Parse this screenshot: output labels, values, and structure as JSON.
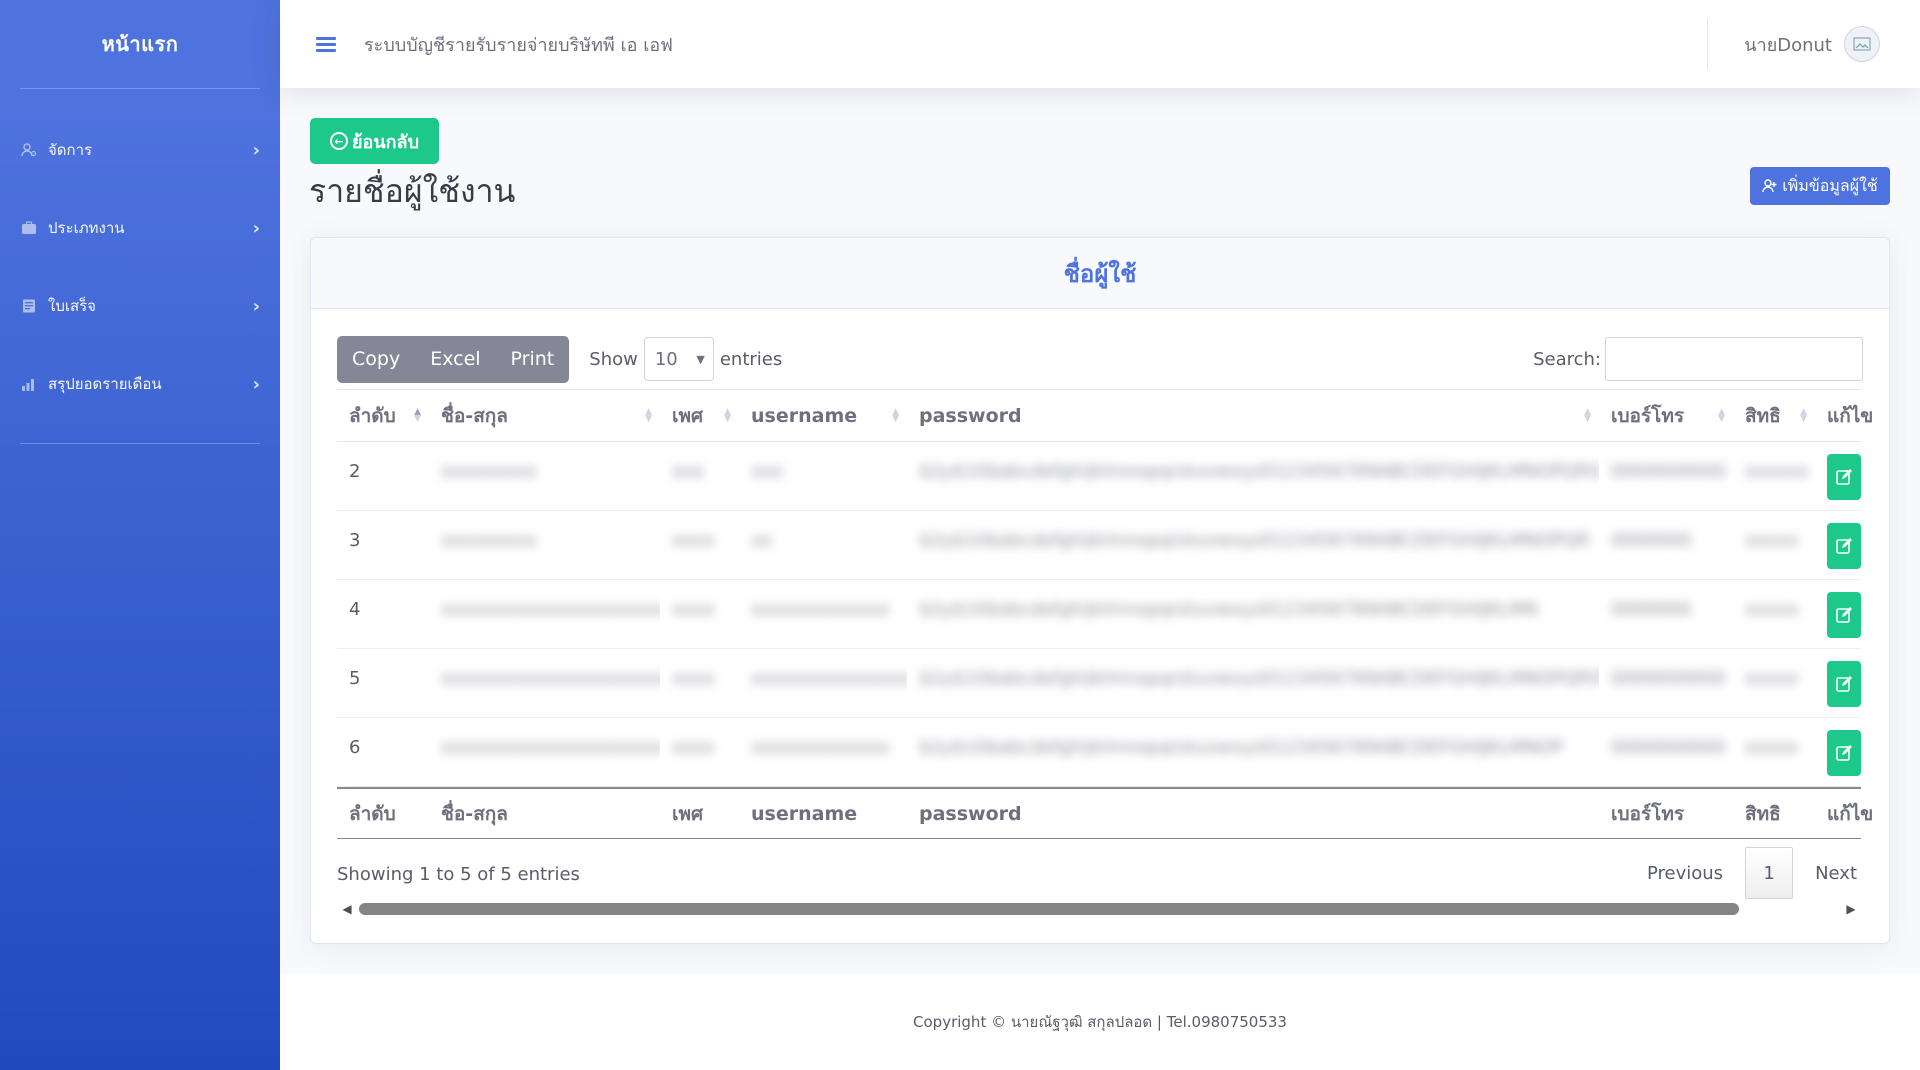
{
  "sidebar": {
    "brand": "หน้าแรก",
    "items": [
      {
        "label": "จัดการ",
        "icon": "users-cog-icon"
      },
      {
        "label": "ประเภทงาน",
        "icon": "briefcase-icon"
      },
      {
        "label": "ใบเสร็จ",
        "icon": "receipt-icon"
      },
      {
        "label": "สรุปยอดรายเดือน",
        "icon": "bar-chart-icon"
      }
    ]
  },
  "topbar": {
    "title": "ระบบบัญชีรายรับรายจ่ายบริษัทพี เอ เอฟ",
    "user_name": "นายDonut"
  },
  "page": {
    "back_label": "ย้อนกลับ",
    "title": "รายชื่อผู้ใช้งาน",
    "add_label": "เพิ่มข้อมูลผู้ใช้"
  },
  "card": {
    "header": "ชื่อผู้ใช้"
  },
  "datatable": {
    "buttons": {
      "copy": "Copy",
      "excel": "Excel",
      "print": "Print"
    },
    "show_label": "Show",
    "entries_label": "entries",
    "page_length": "10",
    "search_label": "Search:",
    "search_value": "",
    "columns": [
      "ลำดับ",
      "ชื่อ-สกุล",
      "เพศ",
      "username",
      "password",
      "เบอร์โทร",
      "สิทธิ",
      "แก้ไข"
    ],
    "rows": [
      {
        "no": "2",
        "name": "xxxxxxxxx",
        "gender": "xxx",
        "username": "xxx",
        "password": "$2y$10$abcdefghijklmnopqrstuvwxyz0123456789ABCDEFGHIJKLMNOPQRS",
        "phone": "0000000000",
        "role": "xxxxxx"
      },
      {
        "no": "3",
        "name": "xxxxxxxxx",
        "gender": "xxxx",
        "username": "xx",
        "password": "$2y$10$abcdefghijklmnopqrstuvwxyz0123456789ABCDEFGHIJKLMNOPQR",
        "phone": "0000000",
        "role": "xxxxx"
      },
      {
        "no": "4",
        "name": "xxxxxxxxxxxxxxxxxxxxx",
        "gender": "xxxx",
        "username": "xxxxxxxxxxxxx",
        "password": "$2y$10$abcdefghijklmnopqrstuvwxyz0123456789ABCDEFGHIJKLMN",
        "phone": "0000000",
        "role": "xxxxx"
      },
      {
        "no": "5",
        "name": "xxxxxxxxxxxxxxxxxxxxxxxxx",
        "gender": "xxxx",
        "username": "xxxxxxxxxxxxxxx",
        "password": "$2y$10$abcdefghijklmnopqrstuvwxyz0123456789ABCDEFGHIJKLMNOPQRST",
        "phone": "0000000000",
        "role": "xxxxx"
      },
      {
        "no": "6",
        "name": "xxxxxxxxxxxxxxxxxxxxx",
        "gender": "xxxx",
        "username": "xxxxxxxxxxxxx",
        "password": "$2y$10$abcdefghijklmnopqrstuvwxyz0123456789ABCDEFGHIJKLMNOP",
        "phone": "0000000000",
        "role": "xxxxx"
      }
    ],
    "info": "Showing 1 to 5 of 5 entries",
    "pager": {
      "previous": "Previous",
      "current": "1",
      "next": "Next"
    }
  },
  "footer": {
    "text": "Copyright © นายณัฐวุฒิ สกุลปลอด | Tel.0980750533"
  },
  "colors": {
    "primary": "#4e73df",
    "success": "#1cc88a",
    "secondary": "#858796"
  }
}
